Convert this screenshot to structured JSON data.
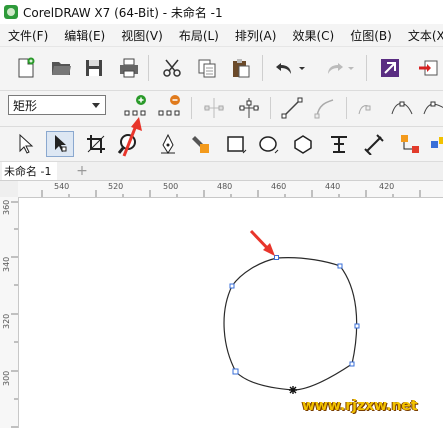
{
  "window": {
    "title": "CorelDRAW X7 (64-Bit) - 未命名 -1"
  },
  "menu": [
    {
      "label": "文件(F)"
    },
    {
      "label": "编辑(E)"
    },
    {
      "label": "视图(V)"
    },
    {
      "label": "布局(L)"
    },
    {
      "label": "排列(A)"
    },
    {
      "label": "效果(C)"
    },
    {
      "label": "位图(B)"
    },
    {
      "label": "文本(X)"
    }
  ],
  "property_bar": {
    "shape_selector_value": "矩形"
  },
  "toolbar_icons": [
    "new-document-icon",
    "open-folder-icon",
    "save-icon",
    "print-icon",
    "cut-icon",
    "copy-icon",
    "paste-icon",
    "undo-icon",
    "redo-icon",
    "import-icon",
    "export-icon"
  ],
  "property_icons": [
    "add-node-icon",
    "delete-node-icon",
    "join-nodes-icon",
    "break-curve-icon",
    "to-line-icon",
    "to-curve-icon",
    "cusp-node-icon",
    "smooth-node-icon",
    "symmetrical-node-icon"
  ],
  "toolbox_icons": [
    "pick-tool-icon",
    "shape-tool-icon",
    "crop-tool-icon",
    "zoom-tool-icon",
    "freehand-tool-icon",
    "artistic-media-icon",
    "rectangle-tool-icon",
    "ellipse-tool-icon",
    "polygon-tool-icon",
    "text-tool-icon",
    "parallel-dimension-icon",
    "connector-tool-icon",
    "blend-tool-icon"
  ],
  "document": {
    "tab_label": "未命名 -1",
    "add_tab_symbol": "+"
  },
  "ruler": {
    "horizontal": [
      "540",
      "520",
      "500",
      "480",
      "460",
      "440",
      "420"
    ],
    "vertical": [
      "360",
      "340",
      "320",
      "300"
    ]
  },
  "watermark": "www.rjzxw.net",
  "colors": {
    "accent_red": "#e8352b",
    "node_blue": "#3a6fd8",
    "add_green": "#2a9a2a",
    "delete_orange": "#e07a1c"
  }
}
